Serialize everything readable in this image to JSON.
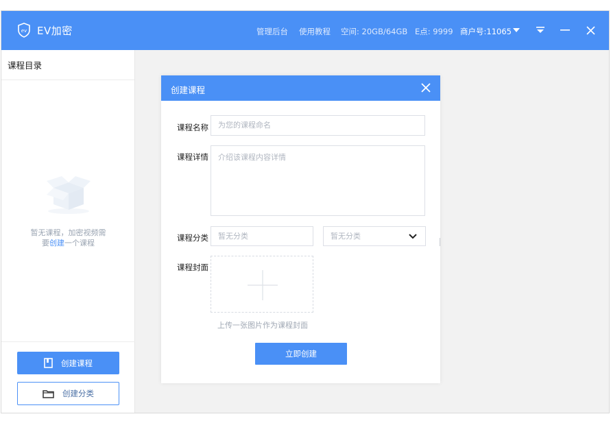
{
  "app": {
    "title": "EV加密",
    "logo_text": "ev"
  },
  "titlebar": {
    "admin_link": "管理后台",
    "tutorial_link": "使用教程",
    "space": "空间: 20GB/64GB",
    "points": "E点: 9999",
    "merchant": "商户号:11065"
  },
  "sidebar": {
    "heading": "课程目录",
    "empty_line1": "暂无课程，加密视频需",
    "empty_line2_before": "要",
    "empty_line2_link": "创建",
    "empty_line2_after": "一个课程",
    "create_course_button": "创建课程",
    "create_category_button": "创建分类"
  },
  "modal": {
    "title": "创建课程",
    "name_label": "课程名称",
    "name_placeholder": "为您的课程命名",
    "detail_label": "课程详情",
    "detail_placeholder": "介绍该课程内容详情",
    "category_label": "课程分类",
    "category_value_1": "暂无分类",
    "category_value_2": "暂无分类",
    "cover_label": "课程封面",
    "cover_hint": "上传一张图片作为课程封面",
    "submit_button": "立即创建"
  },
  "colors": {
    "accent": "#4a90f6"
  }
}
